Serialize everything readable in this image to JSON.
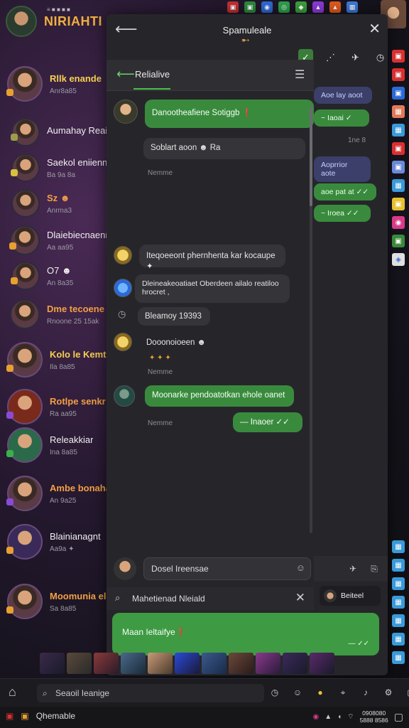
{
  "app": {
    "title": "NIRIAHTI",
    "subtitle": "≡ ■ ■ ■ ■"
  },
  "contacts": [
    {
      "name": "Rllk enande",
      "sub": "Anr8a85",
      "style": "yellow"
    },
    {
      "name": "Aumahay Reain",
      "sub": "",
      "style": "plain"
    },
    {
      "name": "Saekol eniienntr",
      "sub": "Ba 9a 8a",
      "style": "plain"
    },
    {
      "name": "Sz ☻",
      "sub": "Anrma3",
      "style": "orange"
    },
    {
      "name": "Dlaiebiecnaenr",
      "sub": "Aa aa95",
      "style": "plain"
    },
    {
      "name": "O7 ☻",
      "sub": "An 8a35",
      "style": "plain"
    },
    {
      "name": "Dme tecoene",
      "sub": "Rnoone 25 15ak",
      "style": "orange"
    },
    {
      "name": "Kolo le Kemte",
      "sub": "Ila 8a85",
      "style": "yellow"
    },
    {
      "name": "Rotlpe  senkr",
      "sub": "Ra aa95",
      "style": "orange"
    },
    {
      "name": "Releakkiar",
      "sub": "Ina 8a85",
      "style": "plain"
    },
    {
      "name": "Ambe bonaha",
      "sub": "An 9a25",
      "style": "orange"
    },
    {
      "name": "Blainianagnt",
      "sub": "Aa9a ✦",
      "style": "plain"
    },
    {
      "name": "Moomunia ele",
      "sub": "Sa 8a85",
      "style": "orange"
    }
  ],
  "panel": {
    "title": "Spamuleale",
    "sub_title": "Relialive",
    "back_icon": "arrow-left-icon",
    "close_icon": "close-icon"
  },
  "messages": [
    {
      "text": "Danootheafiene Sotiggb ❗",
      "style": "green"
    },
    {
      "text": "Soblart aoon ☻  Ra",
      "style": "dark"
    },
    {
      "text": "Nemme",
      "style": "time"
    },
    {
      "text": "Iteqoeeont phernhenta kar kocaupe ✦",
      "style": "dark"
    },
    {
      "text": "Dleineakeoatiaet Oberdeen ailalo reatiloo hrocret ,",
      "style": "dark"
    },
    {
      "text": "Bleamoy 19393",
      "style": "dark"
    },
    {
      "text": "Dooonoioeen ☻",
      "style": "dark"
    },
    {
      "text": "Nemme",
      "style": "time"
    },
    {
      "text": "Moonarke pendoatotkan ehole oanet",
      "style": "green"
    },
    {
      "text": "Nemme",
      "style": "time"
    },
    {
      "text": "—  Inaoer ✓✓",
      "style": "green"
    }
  ],
  "right_bubbles": [
    {
      "text": "Aoe lay aoot",
      "style": "blue"
    },
    {
      "text": "~ Iaoai ✓",
      "style": "green"
    },
    {
      "text": "1ne 8",
      "style": "time"
    },
    {
      "text": "Aoprrior aote",
      "style": "blue"
    },
    {
      "text": "aoe pat at ✓✓",
      "style": "green"
    },
    {
      "text": "~  Iroea ✓✓",
      "style": "green"
    }
  ],
  "composer": {
    "value": "Dosel Ireensae",
    "search_text": "Mahetienad Nleiald",
    "compose_value": "Maan Ieltaifye❗",
    "send_hint": "— ✓✓",
    "mini_chip": "Beiteel"
  },
  "taskbar": {
    "search_placeholder": "Seaoil Ieanige",
    "status_label": "Qhemable",
    "clock_time": "0908080",
    "clock_date": "5888 8586"
  }
}
